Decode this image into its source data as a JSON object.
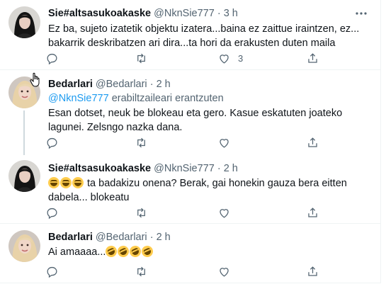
{
  "tweets": [
    {
      "name": "Sie#altsasukoakaske",
      "handle": "@NknSie777",
      "dot": "·",
      "time": "3 h",
      "text": "Ez ba, sujeto izatetik objektu izatera...baina ez zaittue iraintzen, ez... bakarrik deskribatzen ari dira...ta hori da erakusten duten maila",
      "likes": "3"
    },
    {
      "name": "Bedarlari",
      "handle": "@Bedarlari",
      "dot": "·",
      "time": "2 h",
      "reply_handle": "@NknSie777",
      "reply_text": "erabiltzaileari erantzuten",
      "text": "Esan dotset, neuk be blokeau eta gero. Kasue eskatuten joateko lagunei. Zelsngo nazka dana."
    },
    {
      "name": "Sie#altsasukoakaske",
      "handle": "@NknSie777",
      "dot": "·",
      "time": "2 h",
      "text": "ta badakizu onena? Berak, gai honekin gauza bera eitten dabela... blokeatu",
      "emojis": [
        "😂",
        "😂",
        "😂"
      ]
    },
    {
      "name": "Bedarlari",
      "handle": "@Bedarlari",
      "dot": "·",
      "time": "2 h",
      "text": "Ai amaaaa...",
      "emojis": [
        "🤣",
        "🤣",
        "🤣",
        "🤣"
      ]
    }
  ],
  "icons": {
    "reply": "reply-icon",
    "retweet": "retweet-icon",
    "like": "heart-icon",
    "share": "share-icon",
    "more": "more-icon"
  },
  "colors": {
    "link": "#1d9bf0",
    "muted": "#536471",
    "thread_line": "#cfd9de"
  }
}
